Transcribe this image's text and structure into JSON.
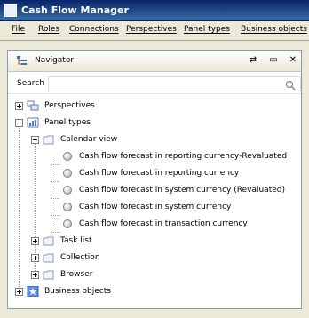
{
  "window": {
    "title": "Cash Flow Manager"
  },
  "menu": [
    "File",
    "Roles",
    "Connections",
    "Perspectives",
    "Panel types",
    "Business objects"
  ],
  "navigator": {
    "title": "Navigator",
    "search_label": "Search",
    "search_value": ""
  },
  "tree": {
    "perspectives": "Perspectives",
    "panel_types": "Panel types",
    "calendar_view": "Calendar view",
    "calendar_items": [
      "Cash flow forecast in reporting currency-Revaluated",
      "Cash flow forecast in reporting currency",
      "Cash flow forecast in system currency (Revaluated)",
      "Cash flow forecast in system currency",
      "Cash flow forecast in transaction currency"
    ],
    "task_list": "Task list",
    "collection": "Collection",
    "browser": "Browser",
    "business_objects": "Business objects"
  }
}
